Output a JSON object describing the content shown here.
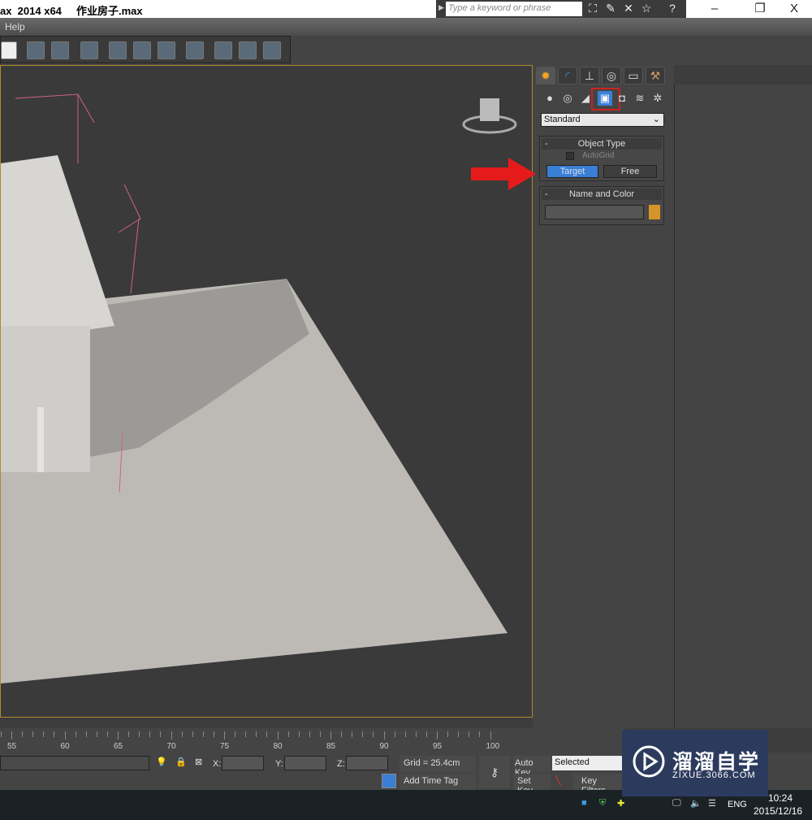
{
  "window": {
    "title": "ax  2014 x64     作业房子.max",
    "minimize": "–",
    "restore": "❐",
    "close": "X"
  },
  "search": {
    "placeholder": "Type a keyword or phrase"
  },
  "menu": {
    "items": [
      "Help"
    ]
  },
  "command_panel": {
    "tabs": [
      "create",
      "modify",
      "hierarchy",
      "motion",
      "display",
      "utilities"
    ],
    "categories": [
      "geometry",
      "shapes",
      "lights",
      "cameras",
      "helpers",
      "space-warps",
      "systems"
    ],
    "selected_category": "cameras",
    "dropdown": "Standard",
    "object_type": {
      "title": "Object Type",
      "autogrid": "AutoGrid",
      "autogrid_checked": false,
      "buttons": [
        "Target",
        "Free"
      ],
      "active": "Target"
    },
    "name_color": {
      "title": "Name and Color",
      "name_value": "",
      "swatch_color": "#d4942a"
    },
    "collapse": "-"
  },
  "timeline": {
    "ticks": [
      "55",
      "60",
      "65",
      "70",
      "75",
      "80",
      "85",
      "90",
      "95",
      "100"
    ]
  },
  "status": {
    "x_label": "X:",
    "y_label": "Y:",
    "z_label": "Z:",
    "grid": "Grid = 25.4cm",
    "add_time_tag": "Add Time Tag",
    "auto_key": "Auto Key",
    "set_key": "Set Key",
    "selected": "Selected",
    "key_filters": "Key Filters..."
  },
  "taskbar": {
    "lang": "ENG",
    "time": "10:24",
    "date": "2015/12/16"
  },
  "watermark": {
    "brand": "溜溜自学",
    "url": "ZIXUE.3066.COM"
  },
  "colors": {
    "viewport_border": "#b08a2a",
    "active_button": "#3a7fd6",
    "highlight": "#cc2222"
  }
}
